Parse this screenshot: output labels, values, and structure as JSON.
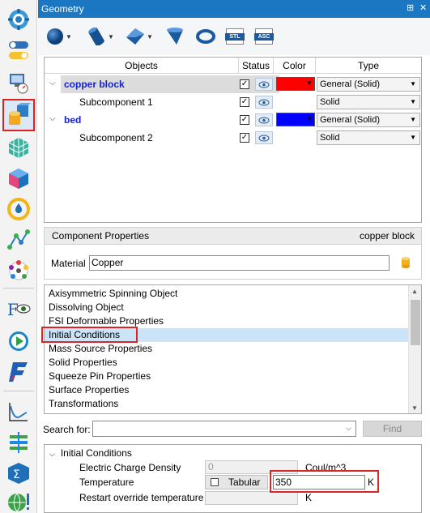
{
  "window": {
    "title": "Geometry",
    "controls": {
      "pin": "⊞",
      "close": "✕"
    }
  },
  "left_toolbar": {
    "items": [
      {
        "name": "globe-gear-icon"
      },
      {
        "name": "toggle-icon"
      },
      {
        "name": "computer-gauge-icon"
      },
      {
        "name": "geometry-blocks-icon",
        "selected": true
      },
      {
        "name": "mesh-cube-icon"
      },
      {
        "name": "box-icon"
      },
      {
        "name": "clock-drop-icon"
      },
      {
        "name": "graph-nodes-icon"
      },
      {
        "name": "color-wheel-icon"
      },
      {
        "name": "function-eye-icon"
      },
      {
        "name": "run-icon"
      },
      {
        "name": "flow3d-icon"
      },
      {
        "name": "chart-icon"
      },
      {
        "name": "layers-icon"
      },
      {
        "name": "sigma-icon"
      },
      {
        "name": "globe-alert-icon"
      }
    ]
  },
  "shape_toolbar": {
    "buttons": [
      "sphere-icon",
      "cylinder-icon",
      "box-icon",
      "cone-icon",
      "torus-icon",
      "stl-icon",
      "asc-icon"
    ],
    "stl_label": "STL",
    "asc_label": "ASC"
  },
  "objects_table": {
    "headers": {
      "objects": "Objects",
      "status": "Status",
      "color": "Color",
      "type": "Type"
    },
    "rows": [
      {
        "name": "copper block",
        "level": 0,
        "checked": true,
        "color": "#ff0000",
        "type": "General (Solid)",
        "highlighted": true
      },
      {
        "name": "Subcomponent 1",
        "level": 1,
        "checked": true,
        "color": null,
        "type": "Solid"
      },
      {
        "name": "bed",
        "level": 0,
        "checked": true,
        "color": "#0000ff",
        "type": "General (Solid)"
      },
      {
        "name": "Subcomponent 2",
        "level": 1,
        "checked": true,
        "color": null,
        "type": "Solid"
      }
    ],
    "check_mark": "✓"
  },
  "component_properties": {
    "label": "Component Properties",
    "component": "copper block",
    "material_label": "Material",
    "material_value": "Copper"
  },
  "property_list": {
    "items": [
      "Axisymmetric Spinning Object",
      "Dissolving Object",
      "FSI Deformable Properties",
      "Initial Conditions",
      "Mass Source Properties",
      "Solid Properties",
      "Squeeze Pin Properties",
      "Surface Properties",
      "Transformations"
    ],
    "selected": "Initial Conditions"
  },
  "search": {
    "label": "Search for:",
    "value": "",
    "find_label": "Find"
  },
  "initial_conditions": {
    "title": "Initial Conditions",
    "rows": {
      "charge_label": "Electric Charge Density",
      "charge_value": "0",
      "charge_unit": "Coul/m^3",
      "temp_label": "Temperature",
      "tabular_label": "Tabular",
      "temp_value": "350",
      "temp_unit": "K",
      "restart_label": "Restart override temperature",
      "restart_value": "",
      "restart_unit": "K"
    }
  }
}
